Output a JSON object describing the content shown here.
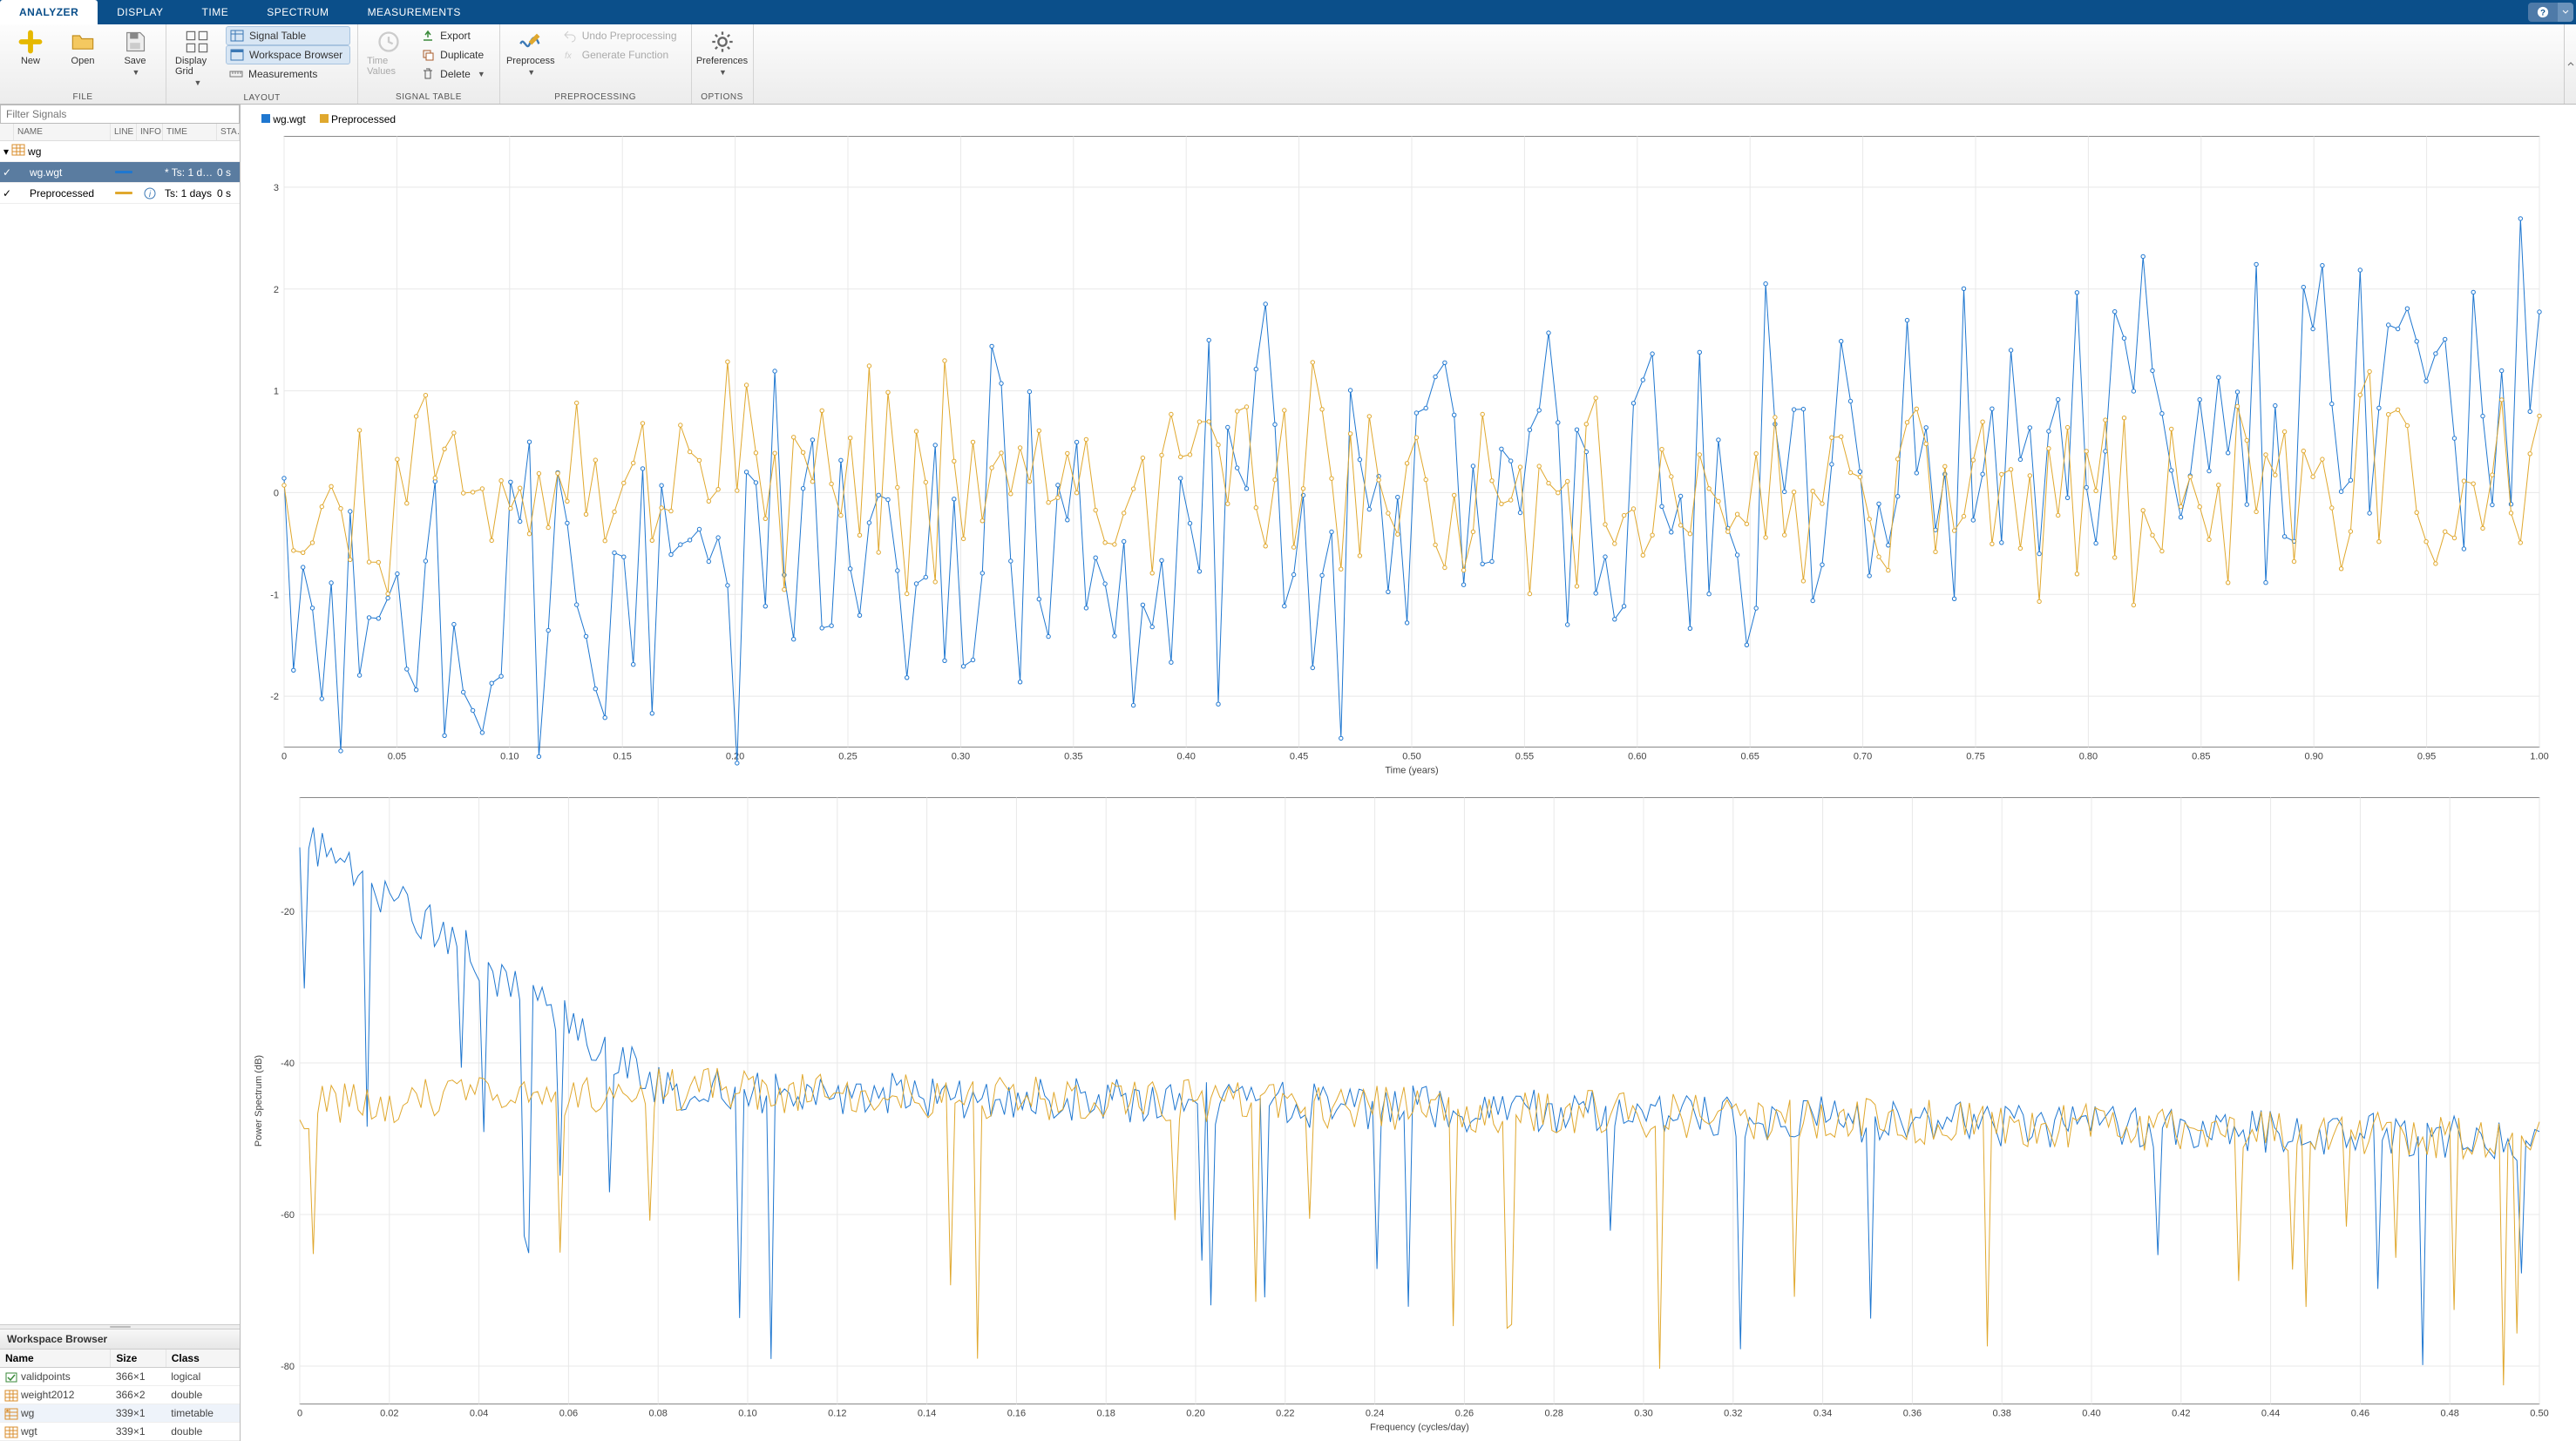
{
  "colors": {
    "blue": "#1f77d0",
    "yellow": "#e0a82e",
    "tabbar": "#0b4f8a"
  },
  "tabs": [
    "ANALYZER",
    "DISPLAY",
    "TIME",
    "SPECTRUM",
    "MEASUREMENTS"
  ],
  "active_tab": 0,
  "ribbon": {
    "file": {
      "title": "FILE",
      "new": "New",
      "open": "Open",
      "save": "Save"
    },
    "layout": {
      "title": "LAYOUT",
      "display_grid": "Display Grid",
      "signal_table": "Signal Table",
      "workspace_browser": "Workspace Browser",
      "measurements": "Measurements"
    },
    "signal_table": {
      "title": "SIGNAL TABLE",
      "time_values": "Time Values",
      "export": "Export",
      "duplicate": "Duplicate",
      "delete": "Delete"
    },
    "preprocessing": {
      "title": "PREPROCESSING",
      "preprocess": "Preprocess",
      "undo": "Undo Preprocessing",
      "generate": "Generate Function"
    },
    "options": {
      "title": "OPTIONS",
      "preferences": "Preferences"
    }
  },
  "filter_placeholder": "Filter Signals",
  "signal_cols": {
    "name": "NAME",
    "line": "LINE",
    "info": "INFO",
    "time": "TIME",
    "start": "STA…"
  },
  "signal_group": "wg",
  "signals": [
    {
      "name": "wg.wgt",
      "color": "#1f77d0",
      "info": "",
      "time": "* Ts: 1 d…",
      "start": "0 s",
      "selected": true,
      "checked": true
    },
    {
      "name": "Preprocessed",
      "color": "#e0a82e",
      "info": "i",
      "time": "Ts: 1 days",
      "start": "0 s",
      "selected": false,
      "checked": true
    }
  ],
  "workspace": {
    "title": "Workspace Browser",
    "cols": {
      "name": "Name",
      "size": "Size",
      "class": "Class"
    },
    "rows": [
      {
        "name": "validpoints",
        "size": "366×1",
        "class": "logical",
        "icon": "check",
        "sel": false
      },
      {
        "name": "weight2012",
        "size": "366×2",
        "class": "double",
        "icon": "num",
        "sel": false
      },
      {
        "name": "wg",
        "size": "339×1",
        "class": "timetable",
        "icon": "tt",
        "sel": true
      },
      {
        "name": "wgt",
        "size": "339×1",
        "class": "double",
        "icon": "num",
        "sel": false
      }
    ]
  },
  "legend": [
    {
      "label": "wg.wgt",
      "color": "#1f77d0"
    },
    {
      "label": "Preprocessed",
      "color": "#e0a82e"
    }
  ],
  "chart_data": [
    {
      "type": "line",
      "title": "",
      "xlabel": "Time (years)",
      "ylabel": "",
      "xlim": [
        0,
        1.0
      ],
      "ylim": [
        -2.5,
        3.5
      ],
      "xticks": [
        0,
        0.05,
        0.1,
        0.15,
        0.2,
        0.25,
        0.3,
        0.35,
        0.4,
        0.45,
        0.5,
        0.55,
        0.6,
        0.65,
        0.7,
        0.75,
        0.8,
        0.85,
        0.9,
        0.95,
        1.0
      ],
      "yticks": [
        -2,
        -1,
        0,
        1,
        2,
        3
      ],
      "markers": "o",
      "note": "Two overlaid noisy daily series (~339 samples). Values estimated from plot; exact data not printed on screen.",
      "series": [
        {
          "name": "wg.wgt",
          "color": "#1f77d0",
          "markers": true,
          "seed": 17,
          "n": 240,
          "amp": 1.6,
          "drift_start": -1.2,
          "drift_end": 1.0,
          "noise": 0.6
        },
        {
          "name": "Preprocessed",
          "color": "#e0a82e",
          "markers": true,
          "seed": 53,
          "n": 240,
          "amp": 0.9,
          "drift_start": 0.1,
          "drift_end": 0.1,
          "noise": 0.45
        }
      ]
    },
    {
      "type": "line",
      "title": "",
      "xlabel": "Frequency (cycles/day)",
      "ylabel": "Power Spectrum (dB)",
      "xlim": [
        0,
        0.5
      ],
      "ylim": [
        -85,
        -5
      ],
      "xticks": [
        0,
        0.02,
        0.04,
        0.06,
        0.08,
        0.1,
        0.12,
        0.14,
        0.16,
        0.18,
        0.2,
        0.22,
        0.24,
        0.26,
        0.28,
        0.3,
        0.32,
        0.34,
        0.36,
        0.38,
        0.4,
        0.42,
        0.44,
        0.46,
        0.48,
        0.5
      ],
      "yticks": [
        -80,
        -60,
        -40,
        -20
      ],
      "note": "Power spectra of the two series; blue has elevated low-frequency power (~ -10 dB near 0) vs yellow (~ -45 dB near 0); both decay toward ~ -50 dB with deep notches reaching -60 to -80 dB.",
      "series": [
        {
          "name": "wg.wgt",
          "color": "#1f77d0",
          "spectrum": true,
          "seed": 9,
          "lowfreq_db": -10
        },
        {
          "name": "Preprocessed",
          "color": "#e0a82e",
          "spectrum": true,
          "seed": 31,
          "lowfreq_db": -46
        }
      ]
    }
  ]
}
